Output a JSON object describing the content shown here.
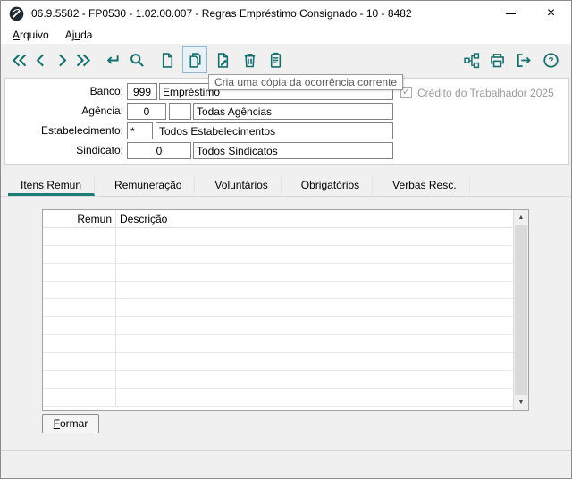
{
  "colors": {
    "accent": "#17706d",
    "window_bg": "#f0f0f0",
    "disabled_text": "#9b9b9b"
  },
  "window": {
    "title": "06.9.5582 - FP0530 - 1.02.00.007 - Regras Empréstimo Consignado - 10 - 8482",
    "close_glyph": "×"
  },
  "menu": {
    "arquivo": {
      "pre": "",
      "accel": "A",
      "post": "rquivo"
    },
    "ajuda": {
      "pre": "Aj",
      "accel": "u",
      "post": "da"
    }
  },
  "toolbar": {
    "buttons": [
      "first-record",
      "previous-record",
      "next-record",
      "last-record",
      "go",
      "search",
      "new-record",
      "copy-record",
      "update-record",
      "delete-record",
      "paste"
    ],
    "right_buttons": [
      "related-programs",
      "print",
      "exit",
      "help"
    ],
    "active_tooltip": "Cria uma cópia da ocorrência corrente"
  },
  "form": {
    "banco": {
      "label": "Banco:",
      "code": "999",
      "name": "Empréstimo"
    },
    "agencia": {
      "label": "Agência:",
      "code": "0",
      "check_digit": "",
      "name": "Todas Agências"
    },
    "estabelecimento": {
      "label": "Estabelecimento:",
      "code": "*",
      "name": "Todos Estabelecimentos"
    },
    "sindicato": {
      "label": "Sindicato:",
      "code": "0",
      "name": "Todos Sindicatos"
    },
    "credito_checkbox": {
      "label": "Crédito do Trabalhador 2025",
      "checked": true,
      "enabled": false
    }
  },
  "tabs": [
    {
      "label": "Itens Remun",
      "selected": true
    },
    {
      "label": "Remuneração",
      "selected": false
    },
    {
      "label": "Voluntários",
      "selected": false
    },
    {
      "label": "Obrigatórios",
      "selected": false
    },
    {
      "label": "Verbas Resc.",
      "selected": false
    }
  ],
  "grid": {
    "columns": [
      "Remun",
      "Descrição"
    ],
    "rows": []
  },
  "footer": {
    "formar": {
      "accel": "F",
      "post": "ormar"
    }
  },
  "icons": {
    "check": "✓",
    "scroll_up": "▲",
    "scroll_down": "▼",
    "help": "?"
  }
}
